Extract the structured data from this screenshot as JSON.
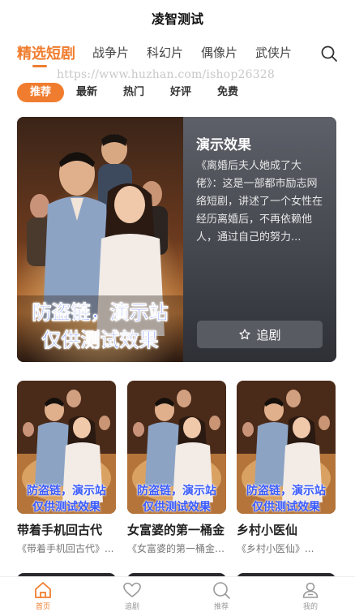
{
  "app": {
    "title": "凌智测试"
  },
  "category_tabs": [
    {
      "label": "精选短剧",
      "active": true
    },
    {
      "label": "战争片",
      "active": false
    },
    {
      "label": "科幻片",
      "active": false
    },
    {
      "label": "偶像片",
      "active": false
    },
    {
      "label": "武侠片",
      "active": false
    }
  ],
  "watermark": "https://www.huzhan.com/ishop26328",
  "sub_tabs": [
    {
      "label": "推荐",
      "active": true
    },
    {
      "label": "最新",
      "active": false
    },
    {
      "label": "热门",
      "active": false
    },
    {
      "label": "好评",
      "active": false
    },
    {
      "label": "免费",
      "active": false
    }
  ],
  "poster_overlay": {
    "line1": "防盗链，演示站",
    "line2": "仅供测试效果"
  },
  "hero": {
    "title": "演示效果",
    "description": "《离婚后夫人她成了大佬》：这是一部都市励志网络短剧，讲述了一个女性在经历离婚后，不再依赖他人，通过自己的努力...",
    "follow_label": "追剧"
  },
  "cards": [
    {
      "title": "带着手机回古代",
      "desc": "《带着手机回古代》..."
    },
    {
      "title": "女富婆的第一桶金",
      "desc": "《女富婆的第一桶金》..."
    },
    {
      "title": "乡村小医仙",
      "desc": "《乡村小医仙》..."
    }
  ],
  "tabbar": [
    {
      "label": "首页",
      "icon": "home-icon",
      "active": true
    },
    {
      "label": "追剧",
      "icon": "heart-icon",
      "active": false
    },
    {
      "label": "推荐",
      "icon": "search-icon",
      "active": false
    },
    {
      "label": "我的",
      "icon": "user-icon",
      "active": false
    }
  ],
  "colors": {
    "accent": "#f07d2f",
    "overlay_text": "#3a5bff"
  }
}
